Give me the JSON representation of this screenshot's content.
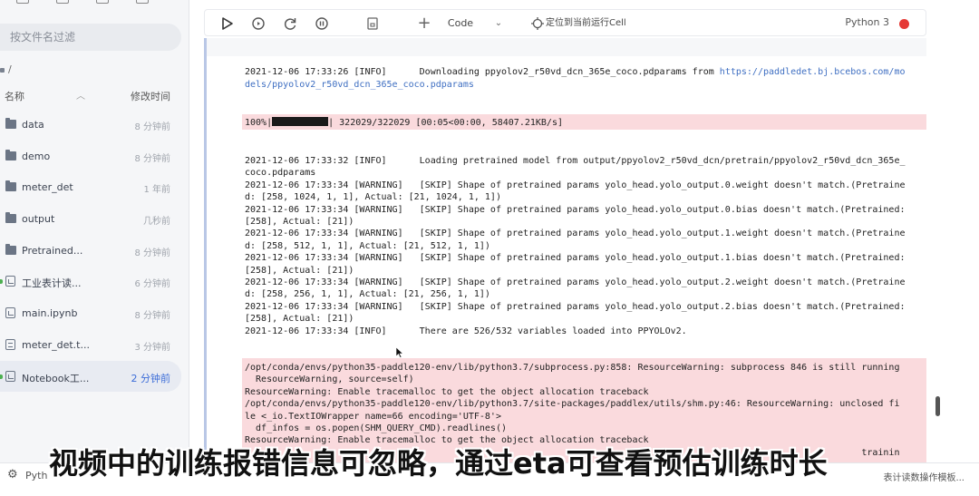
{
  "sidebar": {
    "filter_placeholder": "按文件名过滤",
    "path": "/",
    "col_name": "名称",
    "col_time": "修改时间",
    "files": [
      {
        "name": "data",
        "time": "8 分钟前",
        "icon": "folder-icon"
      },
      {
        "name": "demo",
        "time": "8 分钟前",
        "icon": "folder-icon"
      },
      {
        "name": "meter_det",
        "time": "1 年前",
        "icon": "folder-icon"
      },
      {
        "name": "output",
        "time": "几秒前",
        "icon": "folder-icon"
      },
      {
        "name": "Pretrained...",
        "time": "8 分钟前",
        "icon": "folder-icon"
      },
      {
        "name": "工业表计读...",
        "time": "6 分钟前",
        "icon": "notebook-icon"
      },
      {
        "name": "main.ipynb",
        "time": "8 分钟前",
        "icon": "notebook-icon"
      },
      {
        "name": "meter_det.t...",
        "time": "3 分钟前",
        "icon": "text-file-icon"
      },
      {
        "name": "Notebook工...",
        "time": "2 分钟前",
        "icon": "notebook-icon"
      }
    ]
  },
  "toolbar": {
    "cell_type": "Code",
    "locate_label": "定位到当前运行Cell",
    "kernel_name": "Python 3",
    "kernel_status_color": "#e53935"
  },
  "output": {
    "download_line1_prefix": "2021-12-06 17:33:26 [INFO]      Downloading ppyolov2_r50vd_dcn_365e_coco.pdparams from ",
    "download_line1_link": "https://paddledet.bj.bcebos.com/mo",
    "download_line2_link": "dels/ppyolov2_r50vd_dcn_365e_coco.pdparams",
    "progress_prefix": "100%|",
    "progress_suffix": "| 322029/322029 [00:05<00:00, 58407.21KB/s]",
    "log_lines": [
      "2021-12-06 17:33:32 [INFO]      Loading pretrained model from output/ppyolov2_r50vd_dcn/pretrain/ppyolov2_r50vd_dcn_365e_",
      "coco.pdparams",
      "2021-12-06 17:33:34 [WARNING]   [SKIP] Shape of pretrained params yolo_head.yolo_output.0.weight doesn't match.(Pretraine",
      "d: [258, 1024, 1, 1], Actual: [21, 1024, 1, 1])",
      "2021-12-06 17:33:34 [WARNING]   [SKIP] Shape of pretrained params yolo_head.yolo_output.0.bias doesn't match.(Pretrained:",
      "[258], Actual: [21])",
      "2021-12-06 17:33:34 [WARNING]   [SKIP] Shape of pretrained params yolo_head.yolo_output.1.weight doesn't match.(Pretraine",
      "d: [258, 512, 1, 1], Actual: [21, 512, 1, 1])",
      "2021-12-06 17:33:34 [WARNING]   [SKIP] Shape of pretrained params yolo_head.yolo_output.1.bias doesn't match.(Pretrained:",
      "[258], Actual: [21])",
      "2021-12-06 17:33:34 [WARNING]   [SKIP] Shape of pretrained params yolo_head.yolo_output.2.weight doesn't match.(Pretraine",
      "d: [258, 256, 1, 1], Actual: [21, 256, 1, 1])",
      "2021-12-06 17:33:34 [WARNING]   [SKIP] Shape of pretrained params yolo_head.yolo_output.2.bias doesn't match.(Pretrained:",
      "[258], Actual: [21])",
      "2021-12-06 17:33:34 [INFO]      There are 526/532 variables loaded into PPYOLOv2."
    ],
    "stderr_lines": [
      "/opt/conda/envs/python35-paddle120-env/lib/python3.7/subprocess.py:858: ResourceWarning: subprocess 846 is still running",
      "  ResourceWarning, source=self)",
      "ResourceWarning: Enable tracemalloc to get the object allocation traceback",
      "/opt/conda/envs/python35-paddle120-env/lib/python3.7/site-packages/paddlex/utils/shm.py:46: ResourceWarning: unclosed fi",
      "le <_io.TextIOWrapper name=66 encoding='UTF-8'>",
      "  df_infos = os.popen(SHM_QUERY_CMD).readlines()",
      "ResourceWarning: Enable tracemalloc to get the object allocation traceback",
      "                                                                                                                 trainin"
    ]
  },
  "statusbar": {
    "kernel_short": "Pyth",
    "right_text": "表计读数操作模板..."
  },
  "subtitle": "视频中的训练报错信息可忽略，通过eta可查看预估训练时长"
}
